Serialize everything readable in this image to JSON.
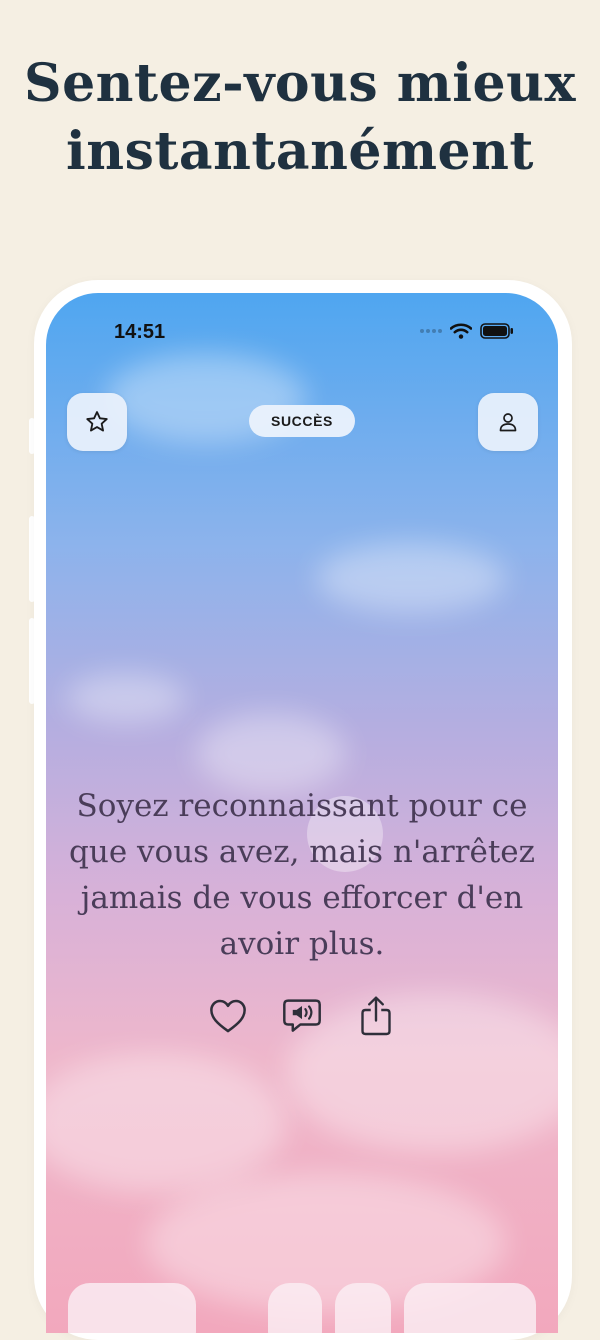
{
  "headline": {
    "line1": "Sentez-vous mieux",
    "line2": "instantanément"
  },
  "status_bar": {
    "time": "14:51"
  },
  "header": {
    "category_label": "SUCCÈS"
  },
  "quote": {
    "text": "Soyez reconnaissant pour ce que vous avez, mais n'arrêtez jamais de vous efforcer d'en avoir plus."
  },
  "icons": {
    "favorites": "star-icon",
    "profile": "person-icon",
    "like": "heart-icon",
    "read_aloud": "speaker-bubble-icon",
    "share": "share-icon",
    "wifi": "wifi-icon",
    "battery": "battery-icon"
  },
  "colors": {
    "page_background": "#f5efe3",
    "headline": "#1f3140",
    "quote_text": "#4a3d59",
    "sky_top": "#4fa6f0",
    "sky_bottom": "#f2a8bd"
  }
}
